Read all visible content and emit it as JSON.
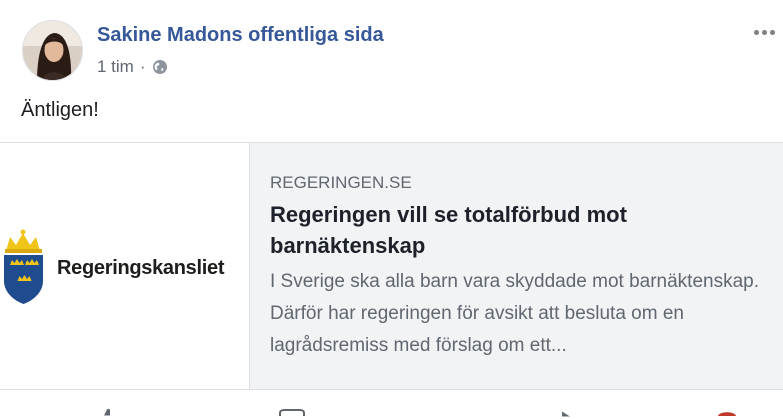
{
  "post": {
    "author": "Sakine Madons offentliga sida",
    "time": "1 tim",
    "separator": "·",
    "privacy_icon": "globe-icon",
    "message": "Äntligen!",
    "more_icon": "more-options-icon"
  },
  "link_preview": {
    "image": {
      "logo_text": "Regeringskansliet",
      "logo_icon": "three-crowns-crest-icon"
    },
    "domain": "REGERINGEN.SE",
    "title": "Regeringen vill se totalförbud mot barnäktenskap",
    "description": "I Sverige ska alla barn vara skyddade mot barnäktenskap. Därför har regeringen för avsikt att besluta om en lagrådsremiss med förslag om ett..."
  },
  "actions": {
    "icons": [
      "like-icon",
      "comment-icon",
      "share-icon",
      "profile-avatar-icon"
    ]
  },
  "colors": {
    "author_link": "#365899",
    "meta_text": "#606770",
    "card_background": "#f2f3f5",
    "crest_blue": "#1f4c8f",
    "crest_gold": "#f0c419"
  }
}
